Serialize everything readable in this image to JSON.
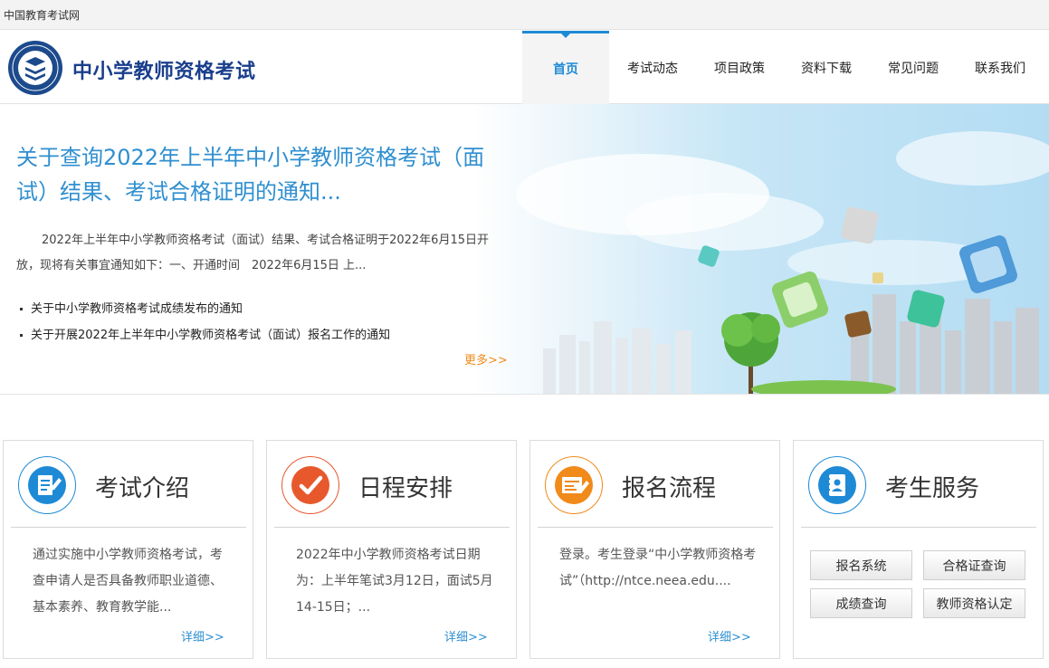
{
  "topbar": {
    "site_label": "中国教育考试网"
  },
  "header": {
    "title": "中小学教师资格考试",
    "nav": [
      "首页",
      "考试动态",
      "项目政策",
      "资料下载",
      "常见问题",
      "联系我们"
    ]
  },
  "banner": {
    "headline": "关于查询2022年上半年中小学教师资格考试（面试）结果、考试合格证明的通知...",
    "summary": "2022年上半年中小学教师资格考试（面试）结果、考试合格证明于2022年6月15日开放，现将有关事宜通知如下：一、开通时间　2022年6月15日 上...",
    "links": [
      "关于中小学教师资格考试成绩发布的通知",
      "关于开展2022年上半年中小学教师资格考试（面试）报名工作的通知"
    ],
    "more": "更多>>"
  },
  "cards": [
    {
      "title": "考试介绍",
      "text": "通过实施中小学教师资格考试，考查申请人是否具备教师职业道德、基本素养、教育教学能...",
      "more": "详细>>",
      "color": "#1e8ad6"
    },
    {
      "title": "日程安排",
      "text": "2022年中小学教师资格考试日期为：上半年笔试3月12日，面试5月14-15日；...",
      "more": "详细>>",
      "color": "#e8582d"
    },
    {
      "title": "报名流程",
      "text": "登录。考生登录“中小学教师资格考试”（http://ntce.neea.edu....",
      "more": "详细>>",
      "color": "#f08a1a"
    },
    {
      "title": "考生服务",
      "buttons": [
        "报名系统",
        "合格证查询",
        "成绩查询",
        "教师资格认定"
      ],
      "color": "#1e8ad6"
    }
  ],
  "colors": {
    "accent": "#1e8ad6",
    "more_link": "#f08a1a",
    "brand_title": "#1a3f8c"
  }
}
